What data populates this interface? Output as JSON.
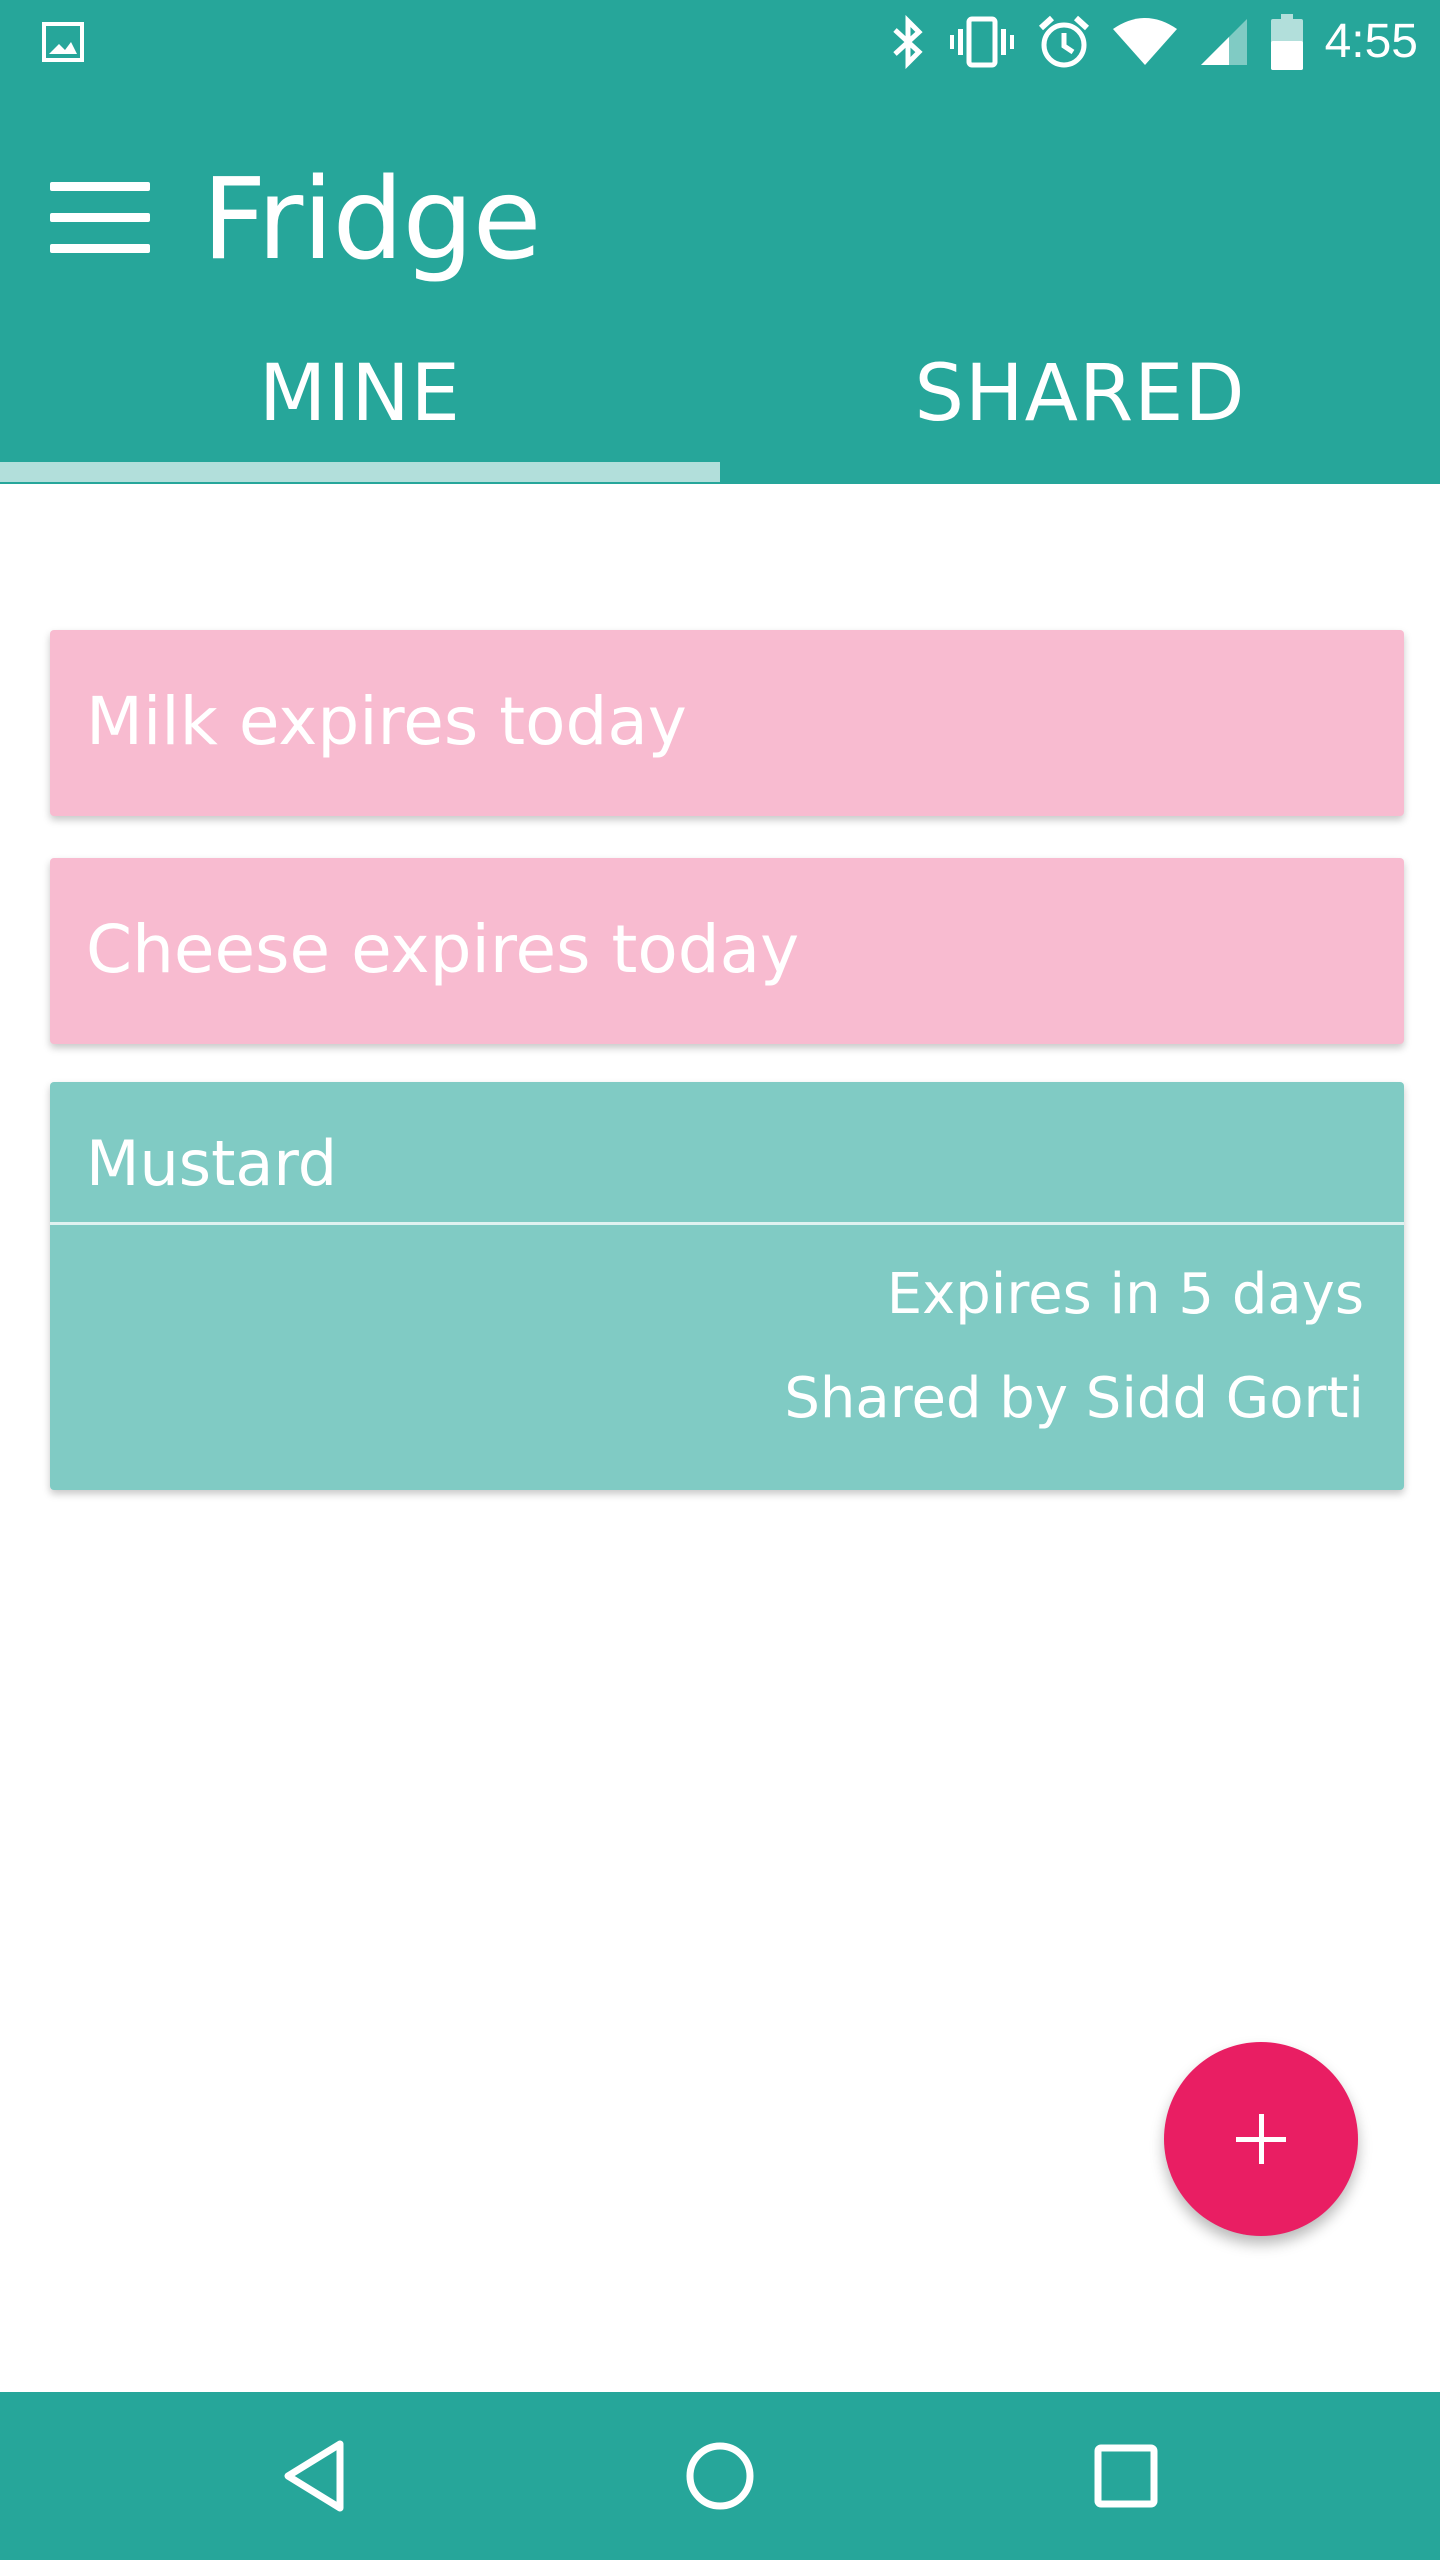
{
  "status_bar": {
    "time": "4:55",
    "icons": [
      "image-notification-icon",
      "bluetooth-icon",
      "vibrate-icon",
      "alarm-icon",
      "wifi-icon",
      "signal-icon",
      "battery-icon"
    ]
  },
  "app_bar": {
    "title": "Fridge",
    "menu_icon": "menu-icon"
  },
  "tabs": [
    {
      "label": "MINE",
      "selected": true
    },
    {
      "label": "SHARED",
      "selected": false
    }
  ],
  "items": [
    {
      "title": "Milk expires today",
      "color": "#f8bbd0"
    },
    {
      "title": "Cheese expires today",
      "color": "#f8bbd0"
    },
    {
      "title": "Mustard",
      "expiry": "Expires in 5 days",
      "shared_by": "Shared by Sidd Gorti",
      "color": "#80cbc4"
    }
  ],
  "fab": {
    "icon": "plus-icon",
    "color": "#e91e63"
  },
  "nav_bar": {
    "icons": [
      "back-icon",
      "home-icon",
      "recents-icon"
    ]
  },
  "colors": {
    "primary": "#26a69a",
    "indicator": "#b2dfdb",
    "accent": "#e91e63"
  }
}
